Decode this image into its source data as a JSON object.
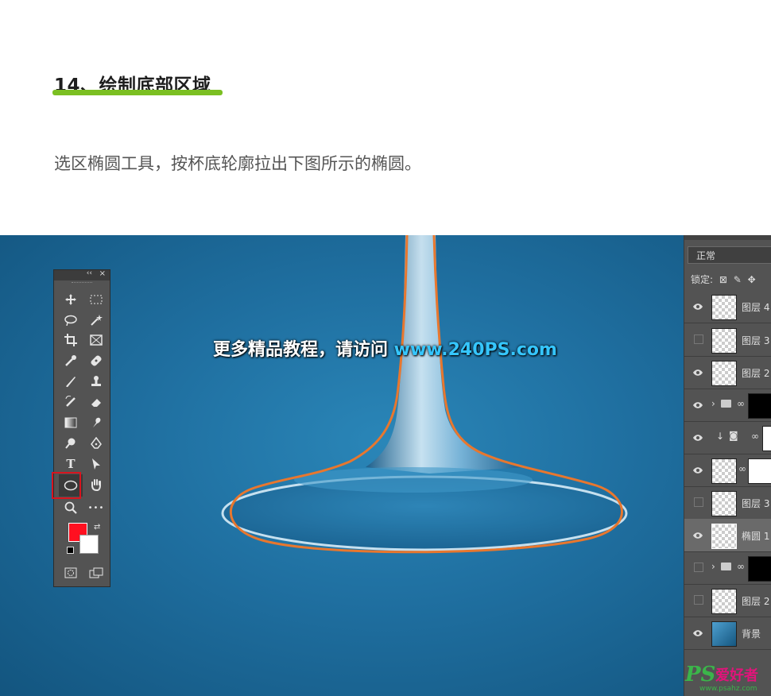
{
  "article": {
    "title": "14、绘制底部区域",
    "description": "选区椭圆工具，按杯底轮廓拉出下图所示的椭圆。"
  },
  "watermark": {
    "text": "更多精品教程，请访问 ",
    "url": "www.240PS.com"
  },
  "toolbox": {
    "collapse_glyph": "‹‹",
    "close_glyph": "×",
    "type_tool_glyph": "T",
    "more_glyph": "•••",
    "active_tool": "ellipse-tool",
    "foreground_color": "#ff1020",
    "background_color": "#ffffff"
  },
  "layers_panel": {
    "blend_mode": "正常",
    "lock_label": "锁定:",
    "layers": [
      {
        "name": "图层 4",
        "visible": true
      },
      {
        "name": "图层 3",
        "visible": false
      },
      {
        "name": "图层 2",
        "visible": true
      },
      {
        "name": "",
        "visible": true,
        "type": "group"
      },
      {
        "name": "",
        "visible": true,
        "type": "adjustment"
      },
      {
        "name": "",
        "visible": true,
        "type": "masked"
      },
      {
        "name": "图层 3",
        "visible": false
      },
      {
        "name": "椭圆 1",
        "visible": true,
        "selected": true
      },
      {
        "name": "",
        "visible": false,
        "type": "group"
      },
      {
        "name": "图层 2",
        "visible": false
      },
      {
        "name": "背景",
        "visible": true
      }
    ]
  },
  "logo": {
    "brand": "PS",
    "name": "爱好者",
    "url": "www.psahz.com"
  },
  "colors": {
    "accent_underline": "#7bbf22",
    "outline": "#e8772e",
    "canvas_blue": "#1f6fa0"
  }
}
